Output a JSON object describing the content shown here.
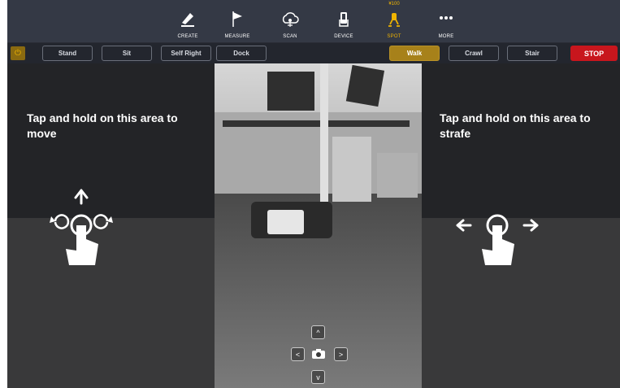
{
  "nav": {
    "items": [
      {
        "label": "CREATE",
        "icon": "pencil-icon"
      },
      {
        "label": "MEASURE",
        "icon": "flag-icon"
      },
      {
        "label": "SCAN",
        "icon": "cloud-scan-icon"
      },
      {
        "label": "DEVICE",
        "icon": "tablet-hand-icon"
      },
      {
        "label": "SPOT",
        "icon": "robot-dog-icon",
        "badge": "¥100",
        "active": true
      },
      {
        "label": "MORE",
        "icon": "more-dots-icon"
      }
    ]
  },
  "controls": {
    "power_icon": "power-icon",
    "stand": "Stand",
    "sit": "Sit",
    "self_right": "Self Right",
    "dock": "Dock",
    "walk": "Walk",
    "crawl": "Crawl",
    "stair": "Stair",
    "stop": "STOP",
    "active_mode": "Walk",
    "colors": {
      "active": "#a7811a",
      "stop": "#c8161d",
      "accent": "#f0b400"
    }
  },
  "camera": {
    "left_hint": "Tap and hold on this area to move",
    "right_hint": "Tap and hold on this area to strafe",
    "buttons": [
      "chevron-up-icon",
      "chevron-left-icon",
      "camera-icon",
      "chevron-right-icon",
      "chevron-down-icon"
    ]
  }
}
